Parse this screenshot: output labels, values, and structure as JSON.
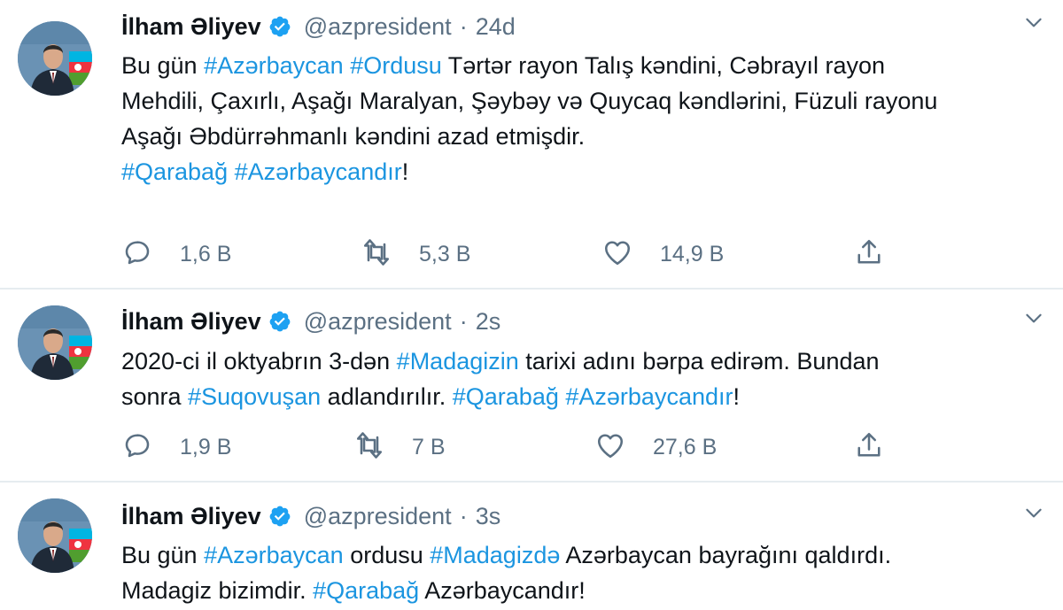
{
  "tweets": [
    {
      "name": "İlham Əliyev",
      "handle": "@azpresident",
      "sep": "·",
      "time": "24d",
      "lines": [
        [
          {
            "t": "Bu gün "
          },
          {
            "t": "#Azərbaycan",
            "tag": true
          },
          {
            "t": " "
          },
          {
            "t": "#Ordusu",
            "tag": true
          },
          {
            "t": " Tərtər rayon Talış kəndini, Cəbrayıl rayon"
          }
        ],
        [
          {
            "t": "Mehdili, Çaxırlı, Aşağı Maralyan, Şəybəy və Quycaq kəndlərini, Füzuli rayonu"
          }
        ],
        [
          {
            "t": "Aşağı Əbdürrəhmanlı kəndini azad etmişdir."
          }
        ],
        [
          {
            "t": " "
          }
        ],
        [
          {
            "t": "#Qarabağ",
            "tag": true
          },
          {
            "t": " "
          },
          {
            "t": "#Azərbaycandır",
            "tag": true
          },
          {
            "t": "!"
          }
        ]
      ],
      "replies": "1,6 B",
      "retweets": "5,3 B",
      "likes": "14,9 B"
    },
    {
      "name": "İlham Əliyev",
      "handle": "@azpresident",
      "sep": "·",
      "time": "2s",
      "lines": [
        [
          {
            "t": "2020-ci il oktyabrın 3-dən "
          },
          {
            "t": "#Madagizin",
            "tag": true
          },
          {
            "t": " tarixi adını bərpa edirəm. Bundan"
          }
        ],
        [
          {
            "t": "sonra "
          },
          {
            "t": "#Suqovuşan",
            "tag": true
          },
          {
            "t": " adlandırılır. "
          },
          {
            "t": "#Qarabağ",
            "tag": true
          },
          {
            "t": " "
          },
          {
            "t": "#Azərbaycandır",
            "tag": true
          },
          {
            "t": "!"
          }
        ]
      ],
      "replies": "1,9 B",
      "retweets": "7 B",
      "likes": "27,6 B"
    },
    {
      "name": "İlham Əliyev",
      "handle": "@azpresident",
      "sep": "·",
      "time": "3s",
      "lines": [
        [
          {
            "t": "Bu gün "
          },
          {
            "t": "#Azərbaycan",
            "tag": true
          },
          {
            "t": " ordusu "
          },
          {
            "t": "#Madagizdə",
            "tag": true
          },
          {
            "t": " Azərbaycan bayrağını qaldırdı."
          }
        ],
        [
          {
            "t": "Madagiz bizimdir. "
          },
          {
            "t": "#Qarabağ",
            "tag": true
          },
          {
            "t": " Azərbaycandır!"
          }
        ]
      ]
    }
  ],
  "icons": {
    "verified": "verified-badge-icon",
    "caret": "chevron-down-icon",
    "reply": "reply-icon",
    "retweet": "retweet-icon",
    "like": "heart-icon",
    "share": "share-icon"
  },
  "colors": {
    "hashtag": "#1b95e0",
    "secondary_text": "#5b7083",
    "verified": "#1da1f2",
    "divider": "#e6ecf0"
  }
}
